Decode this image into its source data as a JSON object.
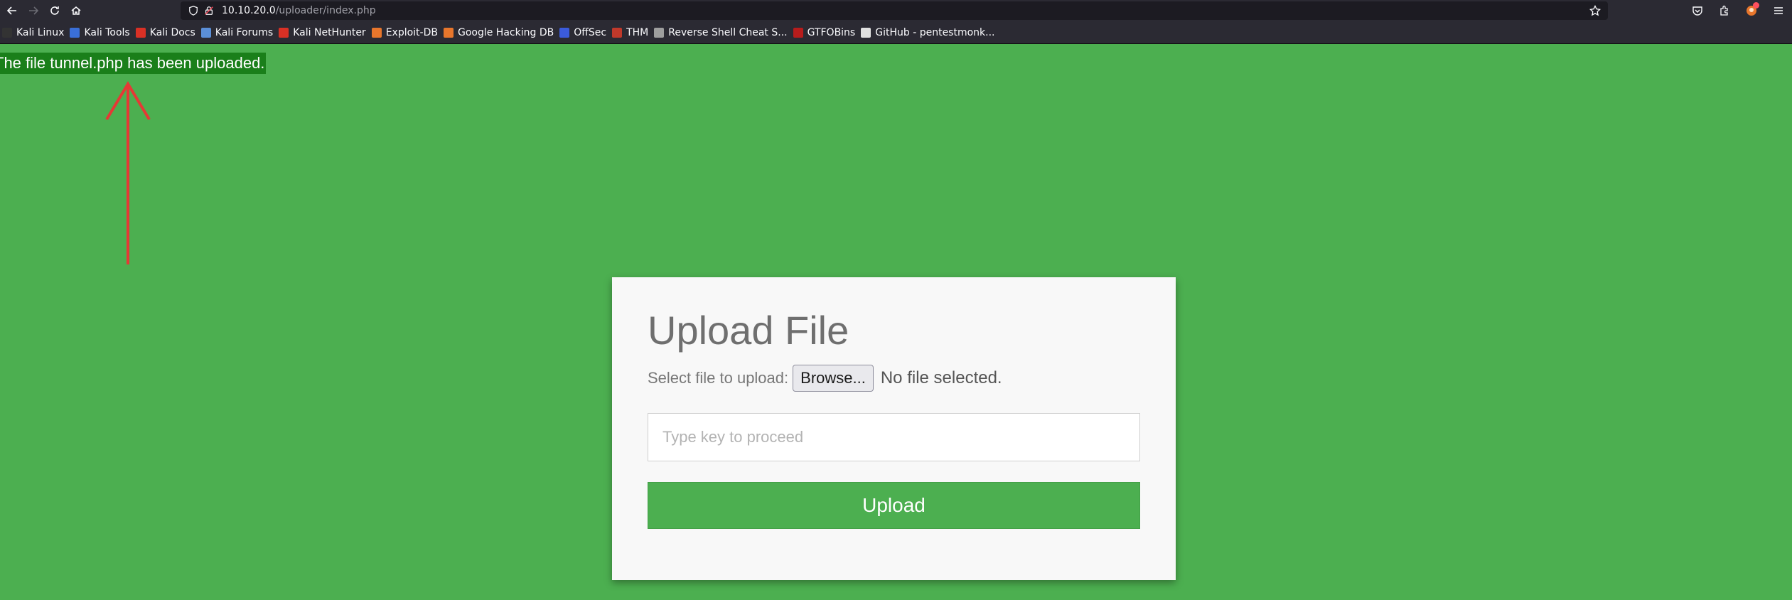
{
  "browser": {
    "url_host": "10.10.20.0",
    "url_path": "/uploader/index.php"
  },
  "bookmarks": [
    {
      "label": "Kali Linux",
      "icon": "kali-dragon-icon",
      "color": "#333333"
    },
    {
      "label": "Kali Tools",
      "icon": "kali-tools-icon",
      "color": "#3a6fd8"
    },
    {
      "label": "Kali Docs",
      "icon": "kali-docs-icon",
      "color": "#d93025"
    },
    {
      "label": "Kali Forums",
      "icon": "kali-forums-icon",
      "color": "#5b8fd8"
    },
    {
      "label": "Kali NetHunter",
      "icon": "nethunter-icon",
      "color": "#d93025"
    },
    {
      "label": "Exploit-DB",
      "icon": "exploit-db-icon",
      "color": "#e8762c"
    },
    {
      "label": "Google Hacking DB",
      "icon": "ghdb-icon",
      "color": "#e8762c"
    },
    {
      "label": "OffSec",
      "icon": "offsec-icon",
      "color": "#3b5bdb"
    },
    {
      "label": "THM",
      "icon": "thm-icon",
      "color": "#c0392b"
    },
    {
      "label": "Reverse Shell Cheat S...",
      "icon": "reverse-shell-icon",
      "color": "#9e9e9e"
    },
    {
      "label": "GTFOBins",
      "icon": "gtfobins-icon",
      "color": "#b71c1c"
    },
    {
      "label": "GitHub - pentestmonk...",
      "icon": "github-icon",
      "color": "#e0e0e0"
    }
  ],
  "page": {
    "upload_message": "The file tunnel.php has been uploaded.",
    "card": {
      "title": "Upload File",
      "file_label": "Select file to upload:",
      "browse_label": "Browse...",
      "no_file_text": "No file selected.",
      "key_placeholder": "Type key to proceed",
      "upload_label": "Upload"
    },
    "colors": {
      "background": "#4caf50",
      "message_bg": "#1a7f1a",
      "arrow": "#e53935"
    }
  }
}
